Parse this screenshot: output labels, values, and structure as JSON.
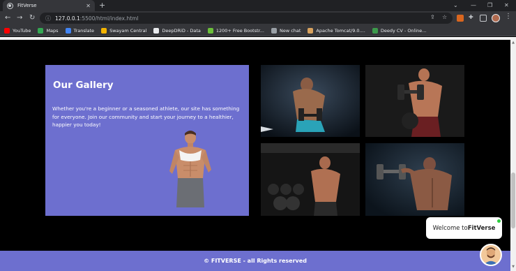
{
  "browser": {
    "tab_title": "FitVerse",
    "tab_close": "✕",
    "new_tab": "+",
    "window_controls": [
      "⌄",
      "—",
      "❐",
      "✕"
    ],
    "url_host": "127.0.0.1",
    "url_rest": ":5500/html/index.html",
    "bookmarks": [
      {
        "label": "YouTube",
        "color": "#ff0000"
      },
      {
        "label": "Maps",
        "color": "#34a853"
      },
      {
        "label": "Translate",
        "color": "#4285f4"
      },
      {
        "label": "Swayam Central",
        "color": "#f4b400"
      },
      {
        "label": "DeepDRiD - Data",
        "color": "#e8eaed"
      },
      {
        "label": "1200+ Free Bootstr...",
        "color": "#6bbf3a"
      },
      {
        "label": "New chat",
        "color": "#9aa0a6"
      },
      {
        "label": "Apache Tomcat/9.0....",
        "color": "#d8a25e"
      },
      {
        "label": "Deedy CV - Online...",
        "color": "#3c9a4b"
      }
    ]
  },
  "gallery": {
    "title": "Our Gallery",
    "text": "Whether you're a beginner or a seasoned athlete, our site has something for everyone. Join our community and start your journey to a healthier, happier you today!",
    "card_color": "#6d6fcf"
  },
  "footer": {
    "text": "© FITVERSE - all Rights reserved"
  },
  "chat": {
    "greeting_prefix": "Welcome to ",
    "brand": "FitVerse"
  }
}
